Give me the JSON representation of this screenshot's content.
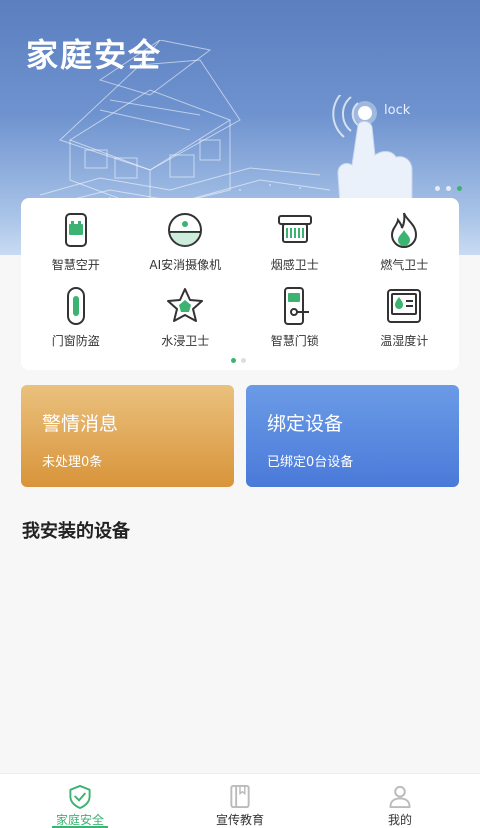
{
  "banner": {
    "title": "家庭安全",
    "lock_text": "lock",
    "dots": 3,
    "active_dot": 2
  },
  "devices": [
    {
      "label": "智慧空开",
      "icon": "smart-breaker-icon"
    },
    {
      "label": "AI安消摄像机",
      "icon": "ai-camera-icon"
    },
    {
      "label": "烟感卫士",
      "icon": "smoke-detector-icon"
    },
    {
      "label": "燃气卫士",
      "icon": "gas-flame-icon"
    },
    {
      "label": "门窗防盗",
      "icon": "door-window-sensor-icon"
    },
    {
      "label": "水浸卫士",
      "icon": "water-leak-icon"
    },
    {
      "label": "智慧门锁",
      "icon": "smart-lock-icon"
    },
    {
      "label": "温湿度计",
      "icon": "thermo-hygrometer-icon"
    }
  ],
  "alert_card": {
    "title": "警情消息",
    "subtitle": "未处理0条"
  },
  "bind_card": {
    "title": "绑定设备",
    "subtitle": "已绑定0台设备"
  },
  "section": {
    "title": "我安装的设备"
  },
  "nav": {
    "items": [
      {
        "label": "家庭安全",
        "icon": "shield-check-icon"
      },
      {
        "label": "宣传教育",
        "icon": "book-icon"
      },
      {
        "label": "我的",
        "icon": "user-icon"
      }
    ],
    "active_index": 0
  },
  "colors": {
    "accent": "#3cb371",
    "banner_top": "#5b7fbf",
    "alert_gradient": [
      "#eac17e",
      "#d8943a"
    ],
    "bind_gradient": [
      "#6b9be6",
      "#4a7ad9"
    ]
  }
}
